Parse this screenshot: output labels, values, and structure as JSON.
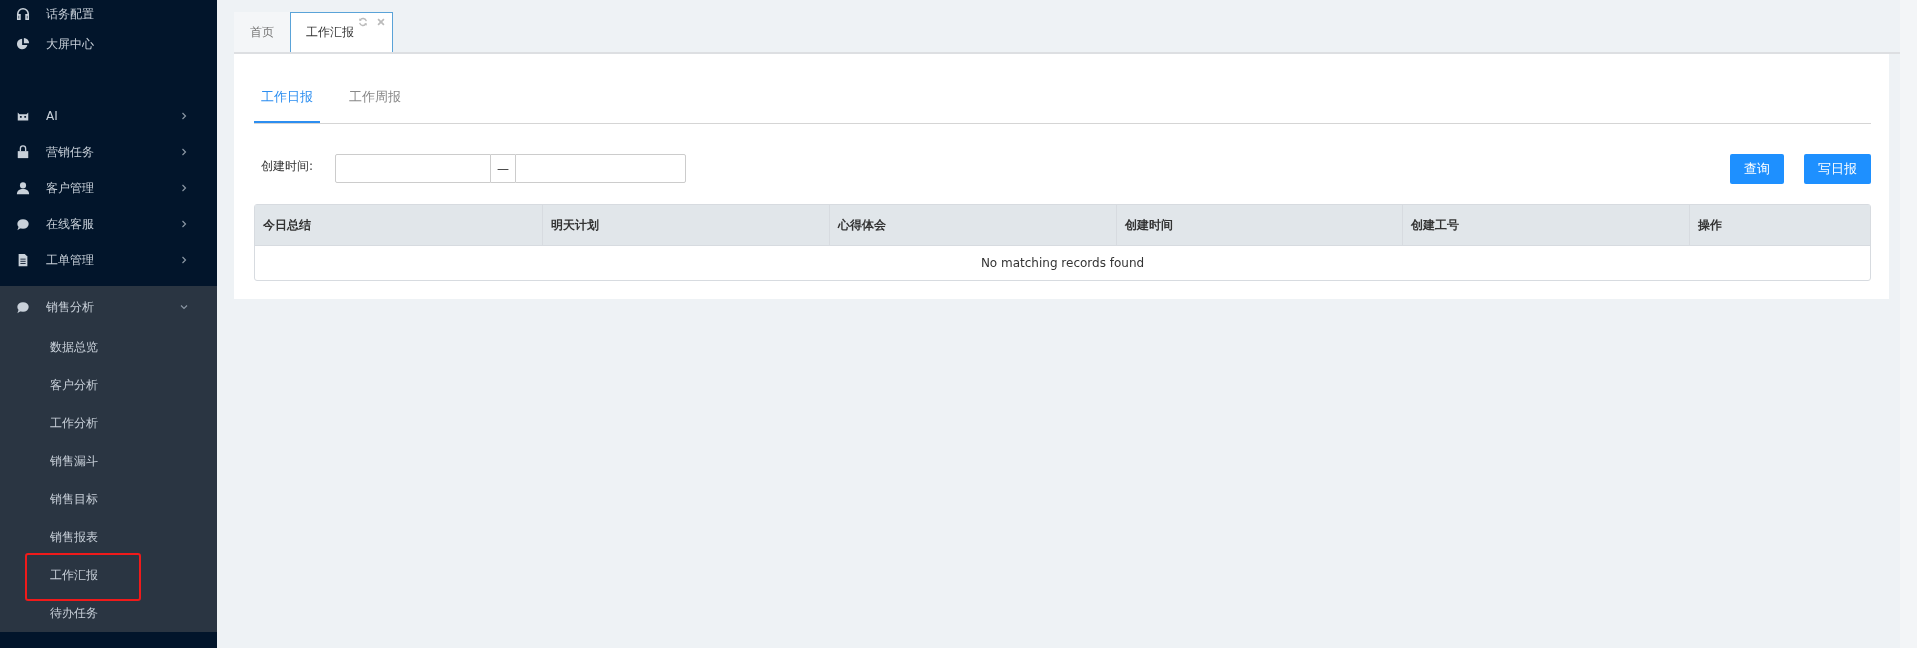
{
  "sidebar": {
    "items": [
      {
        "label": "话务配置",
        "kind": "link",
        "expanded": false
      },
      {
        "label": "大屏中心",
        "kind": "link",
        "expanded": false
      },
      {
        "label": "AI",
        "kind": "group",
        "expanded": false
      },
      {
        "label": "营销任务",
        "kind": "group",
        "expanded": false
      },
      {
        "label": "客户管理",
        "kind": "group",
        "expanded": false
      },
      {
        "label": "在线客服",
        "kind": "group",
        "expanded": false
      },
      {
        "label": "工单管理",
        "kind": "group",
        "expanded": false
      },
      {
        "label": "销售分析",
        "kind": "group",
        "expanded": true,
        "children": [
          {
            "label": "数据总览",
            "highlighted": false
          },
          {
            "label": "客户分析",
            "highlighted": false
          },
          {
            "label": "工作分析",
            "highlighted": false
          },
          {
            "label": "销售漏斗",
            "highlighted": false
          },
          {
            "label": "销售目标",
            "highlighted": false
          },
          {
            "label": "销售报表",
            "highlighted": false
          },
          {
            "label": "工作汇报",
            "highlighted": true
          },
          {
            "label": "待办任务",
            "highlighted": false
          }
        ]
      }
    ]
  },
  "page_tabs": [
    {
      "label": "首页",
      "selected": false
    },
    {
      "label": "工作汇报",
      "selected": true
    }
  ],
  "sub_tabs": [
    {
      "label": "工作日报",
      "selected": true
    },
    {
      "label": "工作周报",
      "selected": false
    }
  ],
  "filter": {
    "label": "创建时间:",
    "separator": "—"
  },
  "buttons": [
    "查询",
    "写日报"
  ],
  "table": {
    "columns": [
      "今日总结",
      "明天计划",
      "心得体会",
      "创建时间",
      "创建工号",
      "操作"
    ],
    "empty_text": "No matching records found"
  }
}
